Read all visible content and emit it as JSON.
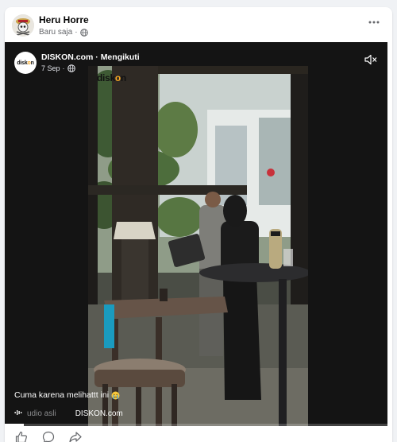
{
  "post": {
    "author": "Heru Horre",
    "timestamp": "Baru saja",
    "separator": "·",
    "audience_icon": "globe-icon",
    "more_icon": "more-horizontal-icon"
  },
  "shared": {
    "page_logo_text_start": "disk",
    "page_logo_text_accent": "o",
    "page_logo_text_end": "n",
    "page_name": "DISKON.com",
    "follow_separator": " · ",
    "follow_status": "Mengikuti",
    "date": "7 Sep",
    "separator": "·",
    "audience_icon": "globe-icon",
    "mute_icon": "speaker-muted-icon",
    "watermark_start": "disk",
    "watermark_accent": "o",
    "watermark_end": "n",
    "caption": "Cuma karena melihattt ini",
    "caption_emoji": "crying-face-emoji",
    "audio_icon": "audio-wave-icon",
    "audio_label": "udio asli",
    "audio_source": "DISKON.com",
    "progress": 0.05,
    "accent_color": "#f5a623"
  },
  "actions": {
    "like_icon": "thumbs-up-icon",
    "comment_icon": "comment-icon",
    "share_icon": "share-icon"
  }
}
